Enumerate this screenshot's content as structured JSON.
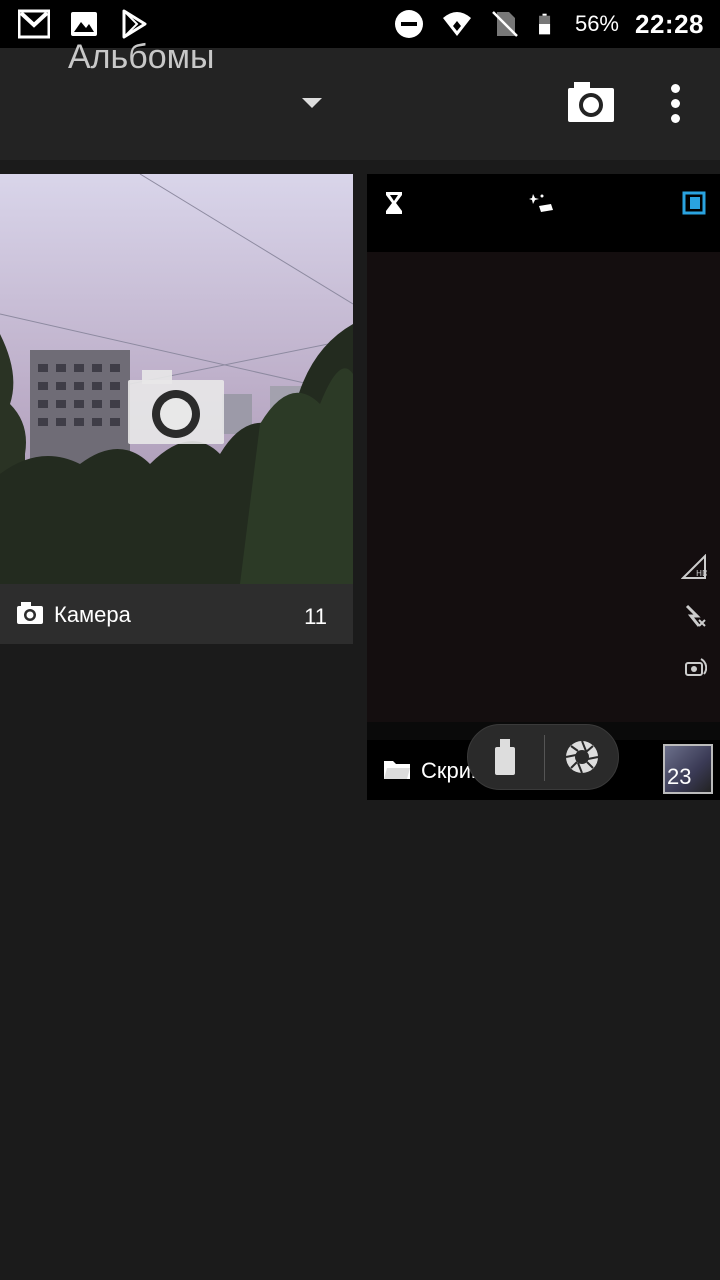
{
  "status_bar": {
    "icons_left": [
      "gmail-icon",
      "image-icon",
      "play-store-icon"
    ],
    "icons_right": [
      "do-not-disturb-icon",
      "wifi-icon",
      "no-sim-icon",
      "battery-icon"
    ],
    "battery": "56%",
    "time": "22:28"
  },
  "app_bar": {
    "title": "Альбомы",
    "actions": [
      "camera-icon",
      "more-vert-icon"
    ]
  },
  "albums": [
    {
      "name": "Камера",
      "count": "11",
      "icon": "camera-icon"
    },
    {
      "name": "Скриншоты",
      "count": "23",
      "icon": "folder-icon"
    }
  ],
  "colors": {
    "background": "#1b1b1b",
    "app_bar": "#232323",
    "status_bar": "#000000",
    "label_bar": "#2d2d2d",
    "accent_blue": "#2aa3e0"
  }
}
